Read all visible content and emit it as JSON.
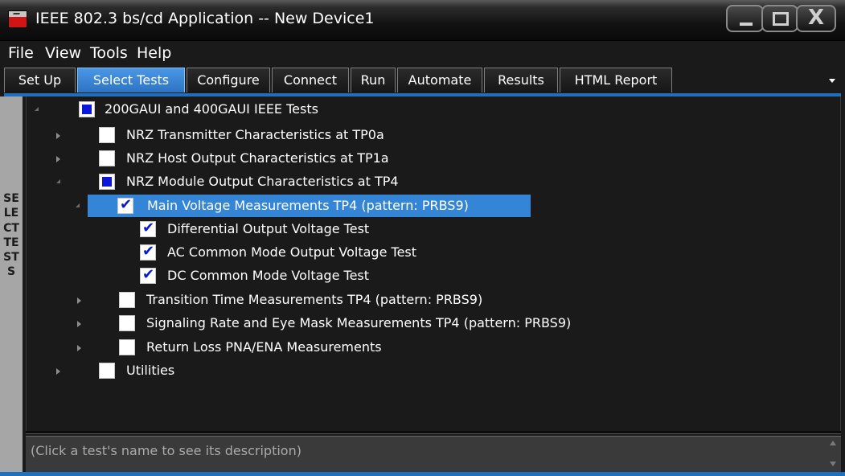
{
  "window": {
    "title": "IEEE 802.3 bs/cd Application -- New Device1"
  },
  "menu": {
    "items": [
      "File",
      "View",
      "Tools",
      "Help"
    ]
  },
  "tabs": [
    {
      "label": "Set Up",
      "active": false
    },
    {
      "label": "Select Tests",
      "active": true
    },
    {
      "label": "Configure",
      "active": false
    },
    {
      "label": "Connect",
      "active": false
    },
    {
      "label": "Run",
      "active": false
    },
    {
      "label": "Automate",
      "active": false
    },
    {
      "label": "Results",
      "active": false
    },
    {
      "label": "HTML Report",
      "active": false
    }
  ],
  "side_label": "SELECT TESTS",
  "tree": [
    {
      "label": "200GAUI and 400GAUI IEEE Tests",
      "state": "partial",
      "expanded": true
    },
    {
      "label": "NRZ Transmitter Characteristics at TP0a",
      "state": "unchecked",
      "expanded": false
    },
    {
      "label": "NRZ Host Output Characteristics at TP1a",
      "state": "unchecked",
      "expanded": false
    },
    {
      "label": "NRZ Module Output Characteristics at TP4",
      "state": "partial",
      "expanded": true
    },
    {
      "label": "Main Voltage Measurements TP4 (pattern: PRBS9)",
      "state": "checked",
      "expanded": true,
      "selected": true
    },
    {
      "label": "Differential Output Voltage Test",
      "state": "checked"
    },
    {
      "label": "AC Common Mode Output Voltage Test",
      "state": "checked"
    },
    {
      "label": "DC Common Mode Voltage Test",
      "state": "checked"
    },
    {
      "label": "Transition Time Measurements TP4 (pattern: PRBS9)",
      "state": "unchecked",
      "expanded": false
    },
    {
      "label": "Signaling Rate and Eye Mask Measurements TP4 (pattern: PRBS9)",
      "state": "unchecked",
      "expanded": false
    },
    {
      "label": "Return Loss PNA/ENA Measurements",
      "state": "unchecked",
      "expanded": false
    },
    {
      "label": "Utilities",
      "state": "unchecked",
      "expanded": false
    }
  ],
  "description": "(Click a test's name to see its description)",
  "colors": {
    "accent": "#3585d7",
    "checkbox_mark": "#0d17d8",
    "background": "#1a1a1a"
  }
}
